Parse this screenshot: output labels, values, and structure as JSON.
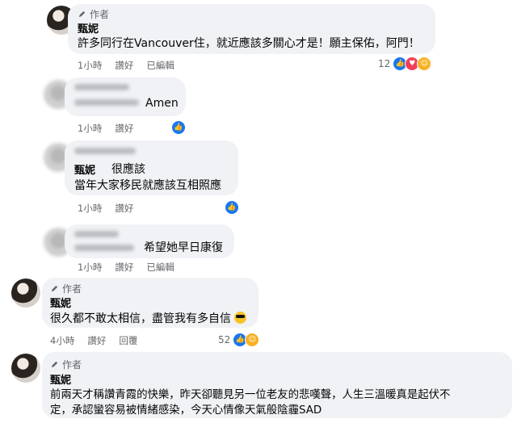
{
  "comments": [
    {
      "author_tag": "作者",
      "name": "甄妮",
      "text": "許多同行在Vancouver住，就近應該多關心才是！願主保佑，阿門！",
      "time": "1小時",
      "like": "讚好",
      "edited": "已編輯",
      "reaction_count": "12"
    },
    {
      "text": "Amen",
      "time": "1小時",
      "like": "讚好"
    },
    {
      "name": "甄妮",
      "line1": "很應該",
      "line2": "當年大家移民就應該互相照應",
      "time": "1小時",
      "like": "讚好"
    },
    {
      "text": "希望她早日康復",
      "time": "1小時",
      "like": "讚好",
      "edited": "已編輯"
    },
    {
      "author_tag": "作者",
      "name": "甄妮",
      "text": "很久都不敢太相信，盡管我有多自信",
      "time": "4小時",
      "like": "讚好",
      "reply": "回覆",
      "reaction_count": "52"
    },
    {
      "author_tag": "作者",
      "name": "甄妮",
      "line1": "前兩天才稱讚青霞的快樂，昨天卻聽見另一位老友的悲嘆聲，人生三溫暖真是起伏不",
      "line2": "定，承認蠻容易被情緒感染，今天心情像天氣般陰霾SAD"
    }
  ],
  "icons": {
    "like": "thumbs-up-icon",
    "love": "heart-icon",
    "care": "care-icon",
    "pen": "pencil-icon",
    "emoji": "sunglasses-emoji-icon"
  },
  "colors": {
    "bubble": "#f0f2f5",
    "meta": "#65676b",
    "like": "#1877f2",
    "love": "#f33e58"
  }
}
